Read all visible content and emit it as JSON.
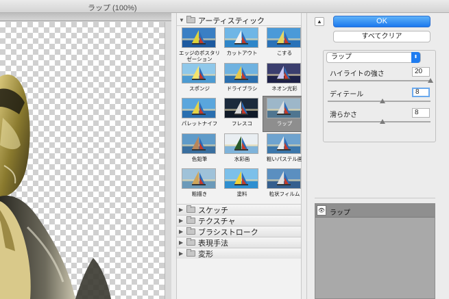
{
  "window": {
    "title": "ラップ (100%)"
  },
  "filter_gallery": {
    "open_category": "アーティスティック",
    "thumbnails": [
      {
        "label": "エッジのポスタリゼーション",
        "selected": false
      },
      {
        "label": "カットアウト",
        "selected": false
      },
      {
        "label": "こする",
        "selected": false
      },
      {
        "label": "スポンジ",
        "selected": false
      },
      {
        "label": "ドライブラシ",
        "selected": false
      },
      {
        "label": "ネオン光彩",
        "selected": false
      },
      {
        "label": "パレットナイフ",
        "selected": false
      },
      {
        "label": "フレスコ",
        "selected": false
      },
      {
        "label": "ラップ",
        "selected": true
      },
      {
        "label": "色鉛筆",
        "selected": false
      },
      {
        "label": "水彩画",
        "selected": false
      },
      {
        "label": "粗いパステル画",
        "selected": false
      },
      {
        "label": "粗描き",
        "selected": false
      },
      {
        "label": "塗料",
        "selected": false
      },
      {
        "label": "粒状フィルム",
        "selected": false
      }
    ],
    "collapsed_categories": [
      "スケッチ",
      "テクスチャ",
      "ブラシストローク",
      "表現手法",
      "変形"
    ]
  },
  "controls": {
    "ok_label": "OK",
    "clear_all_label": "すべてクリア",
    "selected_filter": "ラップ",
    "params": [
      {
        "label": "ハイライトの強さ",
        "value": "20",
        "max": 20,
        "level": 20
      },
      {
        "label": "ディテール",
        "value": "8",
        "max": 15,
        "level": 8
      },
      {
        "label": "滑らかさ",
        "value": "8",
        "max": 15,
        "level": 8
      }
    ]
  },
  "layers": [
    {
      "name": "ラップ"
    }
  ],
  "colors": {
    "accent": "#1c79ee",
    "selected_thumb_bg": "#8e8e8e"
  }
}
